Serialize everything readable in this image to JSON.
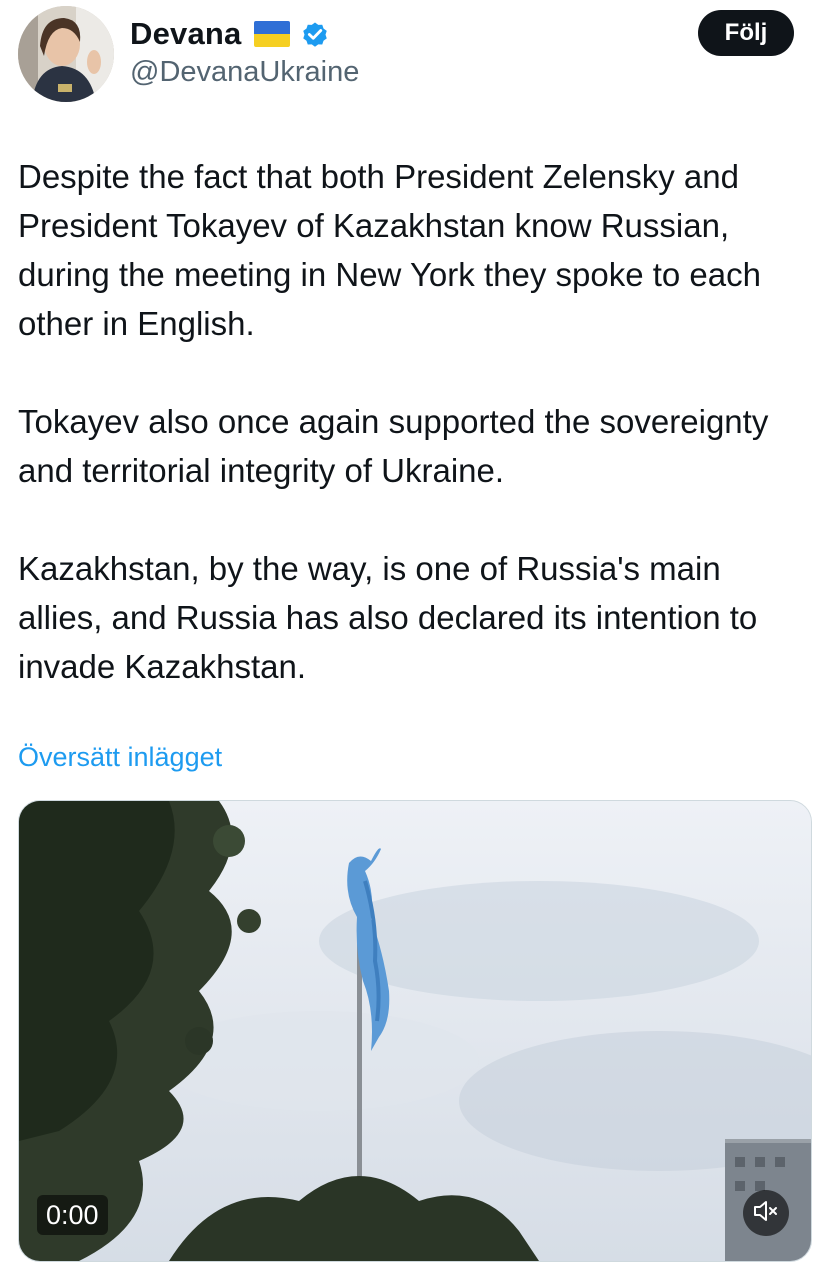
{
  "author": {
    "display_name": "Devana",
    "handle": "@DevanaUkraine",
    "flag_icon": "ukraine-flag-icon",
    "verified_icon": "verified-badge-icon"
  },
  "follow_button": {
    "label": "Följ"
  },
  "post": {
    "paragraphs": [
      "Despite the fact that both President Zelensky and President Tokayev of Kazakhstan know Russian, during the meeting in New York they spoke to each other in English.",
      "Tokayev also once again supported the sovereignty and territorial integrity of Ukraine.",
      "Kazakhstan, by the way, is one of Russia's main allies, and Russia has also declared its intention to invade Kazakhstan."
    ],
    "translate_label": "Översätt inlägget"
  },
  "media": {
    "timestamp": "0:00",
    "mute_icon": "speaker-muted-icon"
  },
  "colors": {
    "text": "#0f1419",
    "secondary_text": "#536471",
    "link": "#1d9bf0",
    "verified": "#1d9bf0",
    "follow_bg": "#0f1419"
  }
}
